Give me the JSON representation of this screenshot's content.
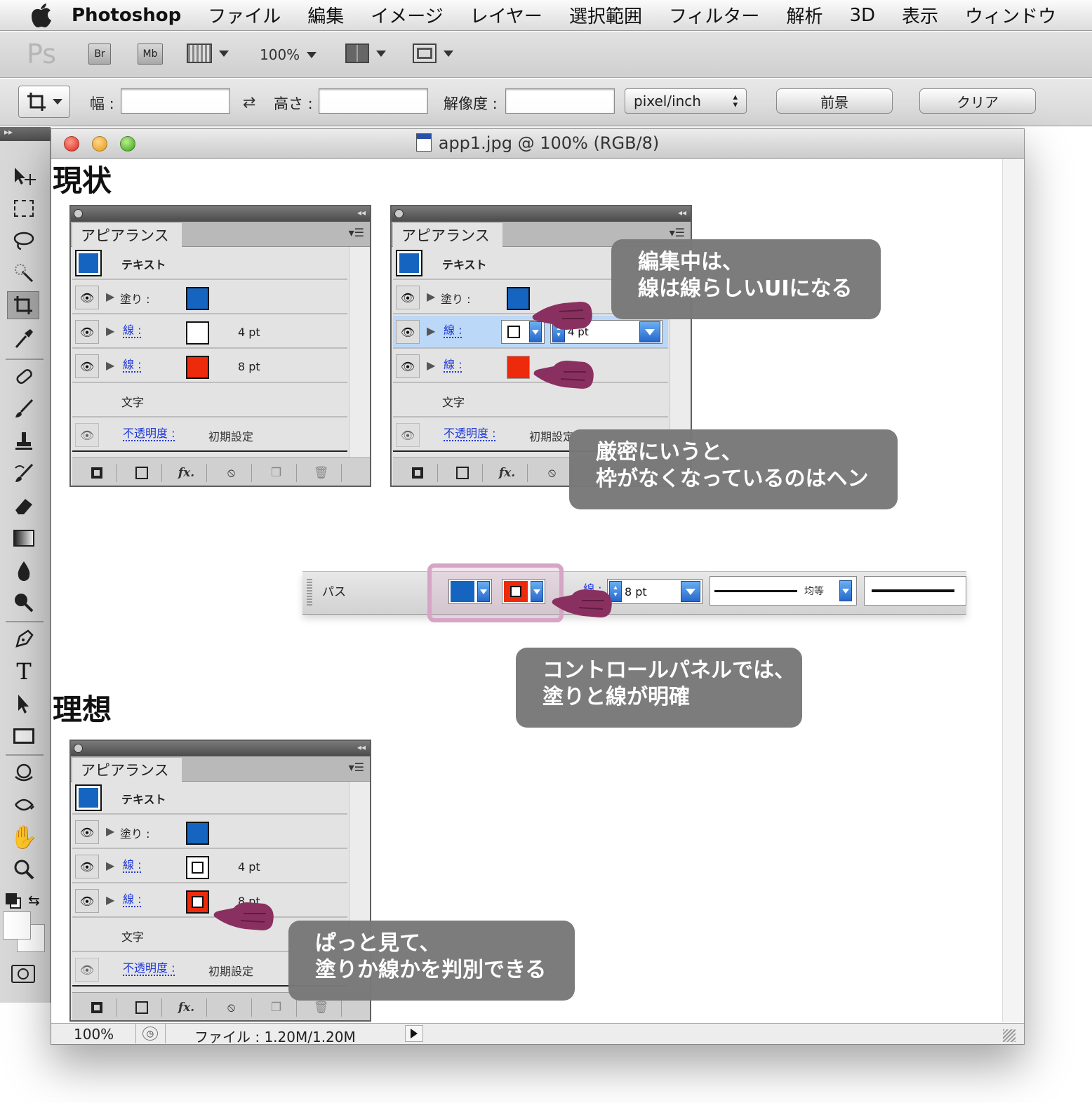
{
  "menubar": {
    "app_name": "Photoshop",
    "items": [
      "ファイル",
      "編集",
      "イメージ",
      "レイヤー",
      "選択範囲",
      "フィルター",
      "解析",
      "3D",
      "表示",
      "ウィンドウ"
    ]
  },
  "appbar": {
    "logo": "Ps",
    "bridge_label": "Br",
    "minibridge_label": "Mb",
    "zoom": "100%"
  },
  "options": {
    "width_label": "幅 :",
    "height_label": "高さ :",
    "resolution_label": "解像度 :",
    "unit": "pixel/inch",
    "front_button": "前景",
    "clear_button": "クリア"
  },
  "document": {
    "title": "app1.jpg @ 100% (RGB/8)",
    "status_zoom": "100%",
    "status_file": "ファイル : 1.20M/1.20M"
  },
  "headings": {
    "current": "現状",
    "ideal": "理想"
  },
  "panel": {
    "tab": "アピアランス",
    "text_row": "テキスト",
    "fill_label": "塗り :",
    "stroke_label": "線 :",
    "stroke1_pt": "4 pt",
    "stroke2_pt": "8 pt",
    "char_row": "文字",
    "opacity_label": "不透明度 :",
    "opacity_value": "初期設定",
    "fx_label": "fx."
  },
  "controlbar": {
    "path_label": "パス",
    "stroke_label": "線 :",
    "stroke_weight": "8 pt",
    "profile_label": "均等"
  },
  "callouts": {
    "editing": [
      "編集中は、",
      "線は線らしいUIになる"
    ],
    "strict": [
      "厳密にいうと、",
      "枠がなくなっているのはヘン"
    ],
    "control": [
      "コントロールパネルでは、",
      "塗りと線が明確"
    ],
    "ideal": [
      "ぱっと見て、",
      "塗りか線かを判別できる"
    ]
  },
  "colors": {
    "fill_blue": "#1565c0",
    "stroke_red": "#ee2a0c",
    "highlight_row": "#bcd8f8",
    "callout_bg": "#787878",
    "hand": "#8a3060",
    "control_highlight": "#d6a4c4"
  }
}
